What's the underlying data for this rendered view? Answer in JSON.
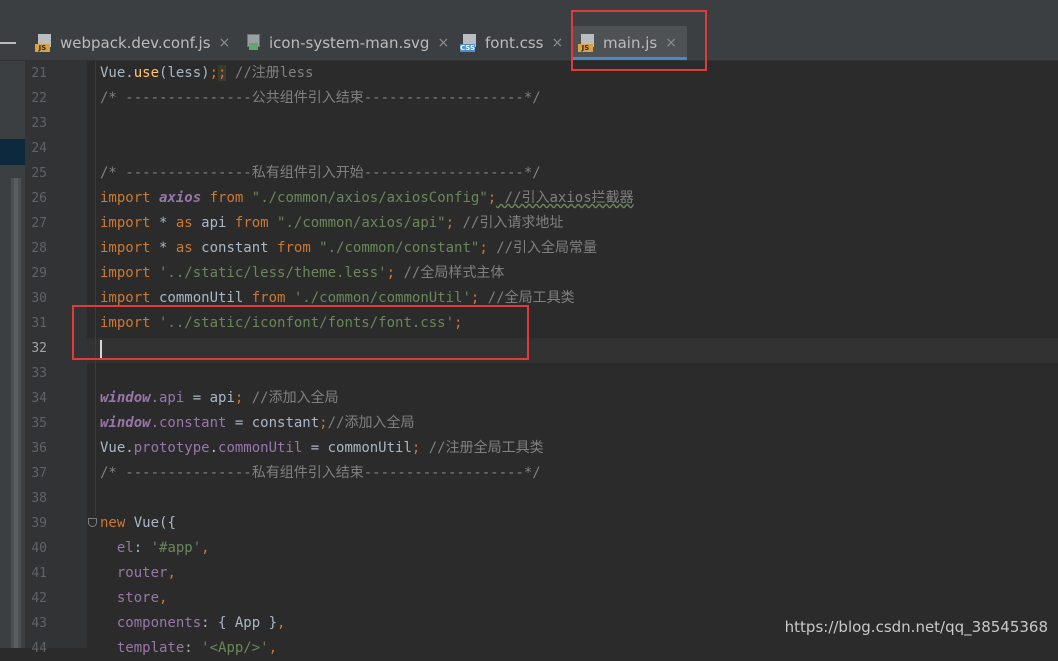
{
  "tabs": [
    {
      "label": "webpack.dev.conf.js",
      "icon": "js-file-icon",
      "active": false
    },
    {
      "label": "icon-system-man.svg",
      "icon": "svg-file-icon",
      "active": false
    },
    {
      "label": "font.css",
      "icon": "css-file-icon",
      "active": false
    },
    {
      "label": "main.js",
      "icon": "js-file-icon",
      "active": true
    }
  ],
  "icon_badges": {
    "js": "JS",
    "css": "CSS"
  },
  "close_glyph": "×",
  "line_numbers": [
    "21",
    "22",
    "23",
    "24",
    "25",
    "26",
    "27",
    "28",
    "29",
    "30",
    "31",
    "32",
    "33",
    "34",
    "35",
    "36",
    "37",
    "38",
    "39",
    "40",
    "41",
    "42",
    "43",
    "44"
  ],
  "current_line": "32",
  "code": {
    "l21_obj": "Vue.",
    "l21_fn": "use",
    "l21_args": "(less)",
    "l21_semi": ";",
    "l21_semi2": ";",
    "l21_cmt": " //注册less",
    "l22": "/* ---------------公共组件引入结束-------------------*/",
    "l25": "/* ---------------私有组件引入开始-------------------*/",
    "l26_kw": "import",
    "l26_id": "axios",
    "l26_from": "from",
    "l26_str": "\"./common/axios/axiosConfig\"",
    "l26_cmt": " //引入axios拦截器",
    "l27_kw": "import",
    "l27_mid": " * ",
    "l27_as": "as",
    "l27_id": " api ",
    "l27_from": "from",
    "l27_str": " \"./common/axios/api\"",
    "l27_cmt": " //引入请求地址",
    "l28_kw": "import",
    "l28_mid": " * ",
    "l28_as": "as",
    "l28_id": " constant ",
    "l28_from": "from",
    "l28_str": " \"./common/constant\"",
    "l28_cmt": " //引入全局常量",
    "l29_kw": "import",
    "l29_str": " '../static/less/theme.less'",
    "l29_cmt": " //全局样式主体",
    "l30_kw": "import",
    "l30_id": " commonUtil ",
    "l30_from": "from",
    "l30_str": " './common/commonUtil'",
    "l30_cmt": " //全局工具类",
    "l31_kw": "import",
    "l31_str": " '../static/iconfont/fonts/font.css'",
    "l34_glob": "window",
    "l34_prop": ".api",
    "l34_rest": " = api",
    "l34_cmt": " //添加入全局",
    "l35_glob": "window",
    "l35_prop": ".constant",
    "l35_rest": " = constant",
    "l35_cmt": "//添加入全局",
    "l36_obj": "Vue.",
    "l36_prop": "prototype",
    "l36_prop2": "commonUtil",
    "l36_rest": " = commonUtil",
    "l36_cmt": " //注册全局工具类",
    "l37": "/* ---------------私有组件引入结束-------------------*/",
    "l39_kw": "new",
    "l39_rest": " Vue({",
    "l40_prop": "  el",
    "l40_str": " '#app'",
    "l41": "  router",
    "l42": "  store",
    "l43_prop": "  components",
    "l43_rest": " { App }",
    "l44_prop": "  template",
    "l44_str": " '<App/>'"
  },
  "watermark": "https://blog.csdn.net/qq_38545368",
  "colors": {
    "keyword": "#cc7832",
    "string": "#6a8759",
    "comment": "#808080",
    "highlight_box": "#e03a3a",
    "active_tab_underline": "#4a88c7"
  }
}
